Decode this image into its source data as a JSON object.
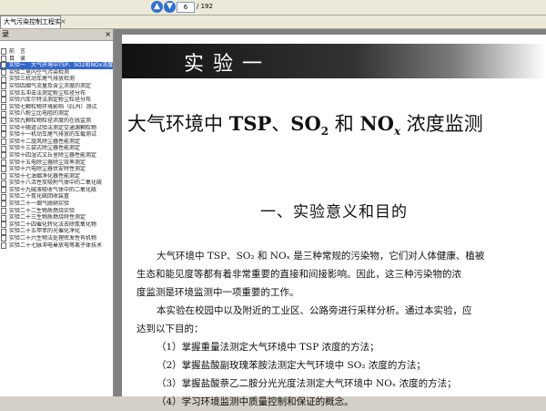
{
  "toolbar": {
    "prev_icon": "arrow-up-icon",
    "next_icon": "arrow-down-icon",
    "page_current": "6",
    "page_total": "/ 192"
  },
  "tab": {
    "label": "大气污染控制工程实验]...",
    "close": "×"
  },
  "sidebar": {
    "header": "录",
    "close": "×",
    "items": [
      "前　言",
      "目　录",
      "实验一　大气环境中TSP、SO2和NOx浓度监测",
      "实验二室内空气污染检测",
      "实验三机动车尾气排放检测",
      "实验四烟气流量及含尘浓度的测定",
      "实验五冲击法测定粉尘粒径分布",
      "实验六库尔特法测定粉尘粒径分布",
      "实验七颗粒物环境影响（ELPI）测试",
      "实验八粉尘比电阻的测定",
      "实验九颗粒物粒径浓度的在线监测",
      "实验十随道试验法测定交通源颗粒物",
      "实验十一机动车尾气排放的车载测试",
      "实验十二旋风除尘器性能测定",
      "实验十三袋式除尘器性能测定",
      "实验十四湿式文丘里除尘器性能测定",
      "实验十五电除尘器除尘效率测定",
      "实验十六电除尘器伏安特性测定",
      "实验十七油烟净化器性能测定",
      "实验十八活性炭吸附气体中的二氧化硫",
      "实验十九碱液吸收气体中的二氧化硫",
      "实验二十氮化硫回收装置",
      "实验二十一烟气脱硝实验",
      "实验二十二生物质燃烧实验",
      "实验二十三生物质燃烧特性测定",
      "实验二十四催化转化法去除氮氧化物",
      "实验二十五甲苯的光催化净化",
      "实验二十六生物法处理挥发性有机物",
      "实验二十七脉冲电晕放电等离子体技术"
    ]
  },
  "page": {
    "banner": "实验一",
    "title_parts": [
      "大气环境中 ",
      "TSP",
      "、",
      "SO",
      "2",
      " 和 ",
      "NO",
      "x",
      " 浓度监测"
    ],
    "section": "一、实验意义和目的",
    "paragraphs": [
      "大气环境中 TSP、SO₂ 和 NOₓ 是三种常规的污染物，它们对人体健康、植被",
      "生态和能见度等都有着非常重要的直接和间接影响。因此，这三种污染物的浓",
      "度监测是环境监测中一项重要的工作。",
      "本实验在校园中以及附近的工业区、公路旁进行采样分析。通过本实验，应",
      "达到以下目的：",
      "（1）掌握重量法测定大气环境中 TSP 浓度的方法；",
      "（2）掌握盐酸副玫瑰苯胺法测定大气环境中 SO₂ 浓度的方法；",
      "（3）掌握盐酸萘乙二胺分光光度法测定大气环境中 NOₓ 浓度的方法；",
      "（4）学习环境监测中质量控制和保证的概念。"
    ]
  }
}
